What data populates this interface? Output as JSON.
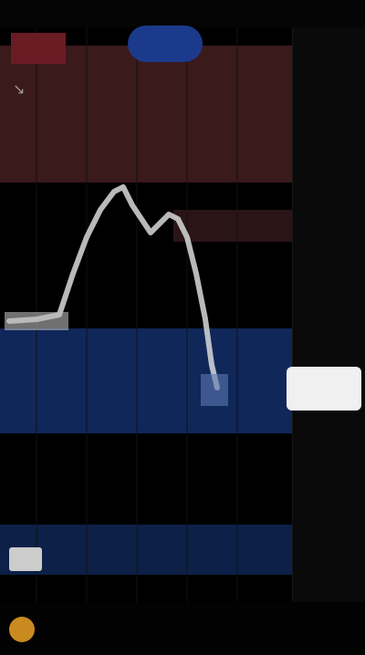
{
  "header": {
    "title": "",
    "time": ""
  },
  "price_scale": {
    "ticks": [
      "",
      "",
      "",
      "",
      "",
      "",
      "",
      "",
      "",
      "",
      "",
      "",
      "",
      "",
      "",
      ""
    ],
    "last_price": ""
  },
  "footer": {
    "label": ""
  },
  "colors": {
    "background": "#000000",
    "red_zone": "#3b1a1c",
    "blue_zone": "#10275a",
    "price_line": "#d9d9d9",
    "last_price_bg": "#f0f0f0",
    "pill_blue": "#1b3a8c",
    "accent_orange": "#c98a20"
  },
  "icons": {
    "footer_icon": "coin-icon",
    "chart_arrow": "arrow-icon"
  }
}
